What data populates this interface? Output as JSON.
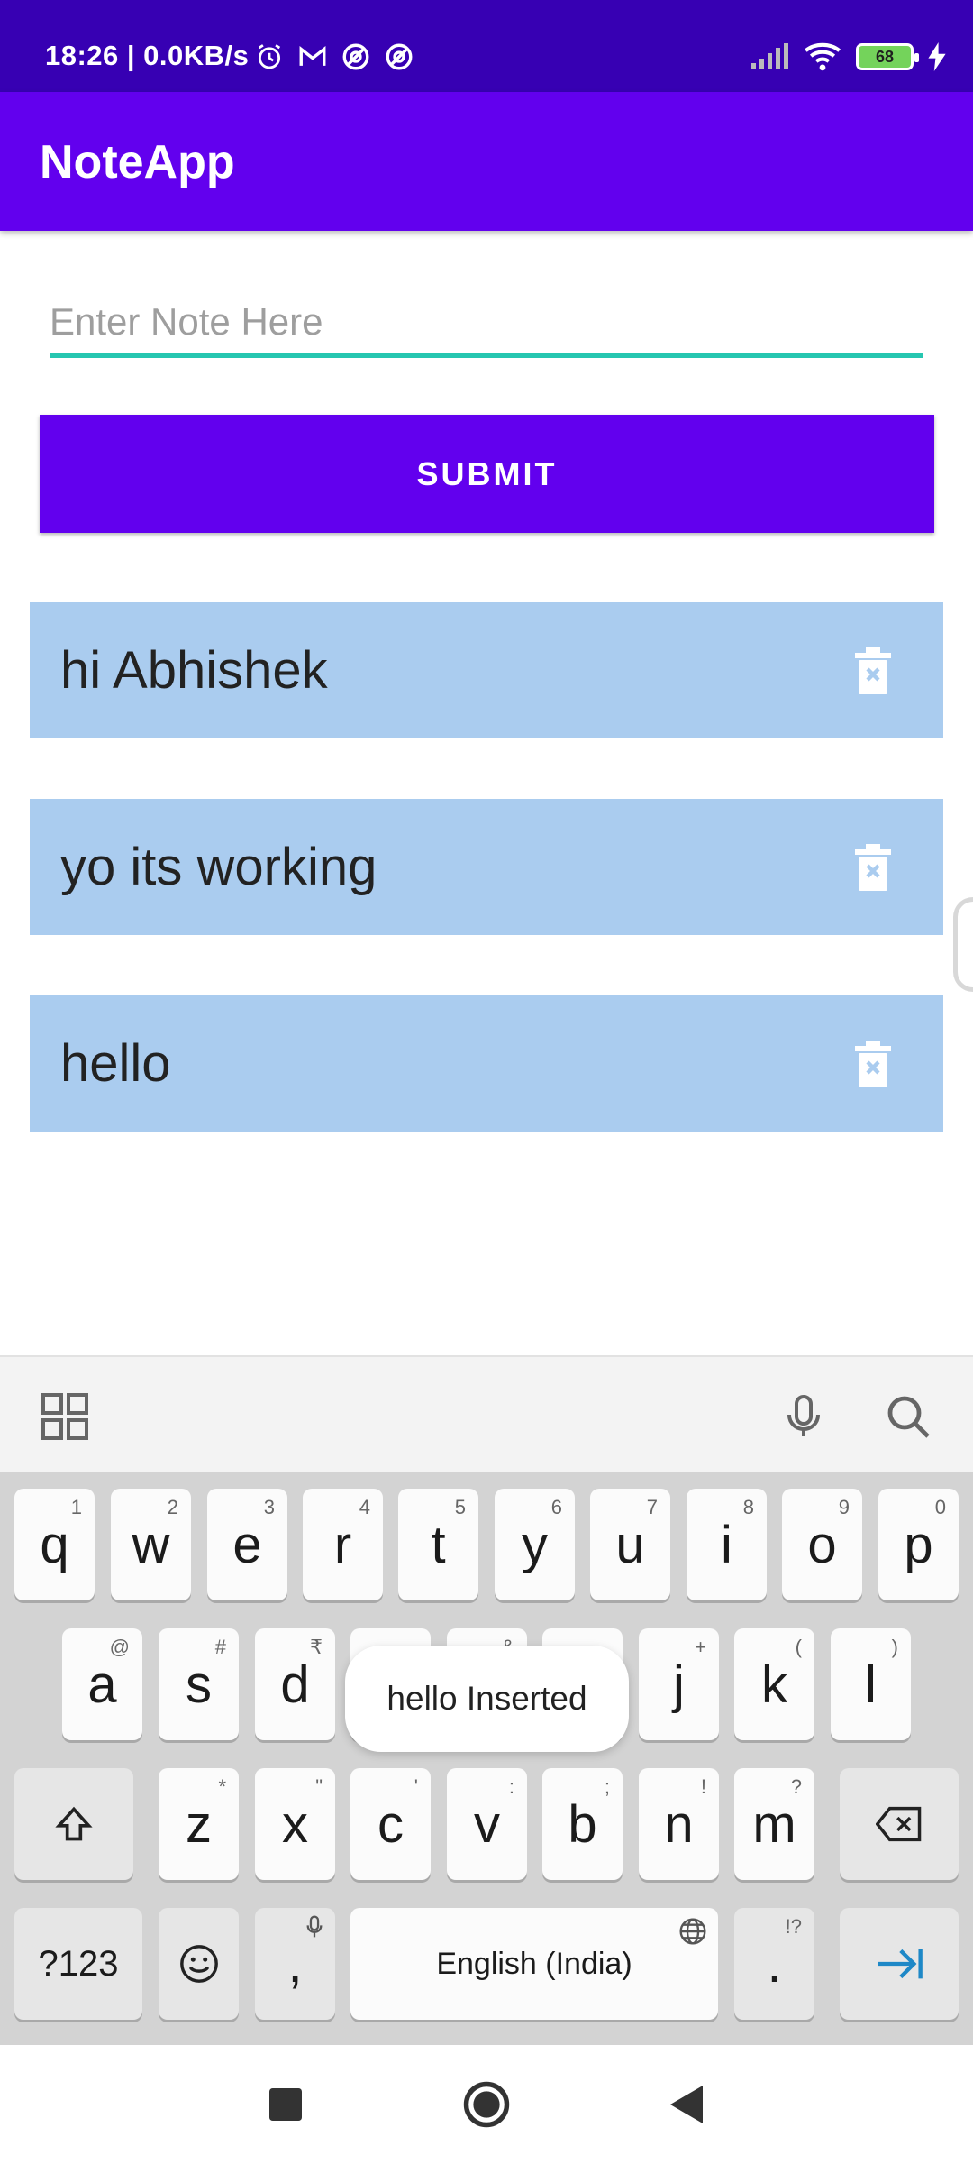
{
  "status_bar": {
    "time_speed": "18:26 | 0.0KB/s",
    "battery": "68",
    "icons": [
      "alarm-icon",
      "gmail-icon",
      "vpn-icon",
      "vpn-icon",
      "signal-icon",
      "wifi-icon",
      "battery-icon",
      "charging-icon"
    ]
  },
  "app_bar": {
    "title": "NoteApp"
  },
  "input": {
    "placeholder": "Enter Note Here",
    "value": ""
  },
  "submit_label": "SUBMIT",
  "notes": [
    {
      "text": "hi Abhishek",
      "icon": "delete-icon"
    },
    {
      "text": "yo its working",
      "icon": "delete-icon"
    },
    {
      "text": "hello",
      "icon": "delete-icon"
    }
  ],
  "keyboard": {
    "toolbar_icons": [
      "grid-icon",
      "mic-icon",
      "search-icon"
    ],
    "row1": [
      {
        "key": "q",
        "hint": "1"
      },
      {
        "key": "w",
        "hint": "2"
      },
      {
        "key": "e",
        "hint": "3"
      },
      {
        "key": "r",
        "hint": "4"
      },
      {
        "key": "t",
        "hint": "5"
      },
      {
        "key": "y",
        "hint": "6"
      },
      {
        "key": "u",
        "hint": "7"
      },
      {
        "key": "i",
        "hint": "8"
      },
      {
        "key": "o",
        "hint": "9"
      },
      {
        "key": "p",
        "hint": "0"
      }
    ],
    "row2": [
      {
        "key": "a",
        "hint": "@"
      },
      {
        "key": "s",
        "hint": "#"
      },
      {
        "key": "d",
        "hint": "₹"
      },
      {
        "key": "f",
        "hint": ""
      },
      {
        "key": "g",
        "hint": "&"
      },
      {
        "key": "h",
        "hint": ""
      },
      {
        "key": "j",
        "hint": "+"
      },
      {
        "key": "k",
        "hint": "("
      },
      {
        "key": "l",
        "hint": ")"
      }
    ],
    "row3": [
      {
        "key": "z",
        "hint": "*"
      },
      {
        "key": "x",
        "hint": "\""
      },
      {
        "key": "c",
        "hint": "'"
      },
      {
        "key": "v",
        "hint": ":"
      },
      {
        "key": "b",
        "hint": ";"
      },
      {
        "key": "n",
        "hint": "!"
      },
      {
        "key": "m",
        "hint": "?"
      }
    ],
    "row4": {
      "symbols": "?123",
      "comma": ",",
      "space": "English (India)",
      "period": ".",
      "period_hint": "!?"
    }
  },
  "toast": "hello Inserted",
  "nav_icons": [
    "recents-icon",
    "home-icon",
    "back-icon"
  ]
}
